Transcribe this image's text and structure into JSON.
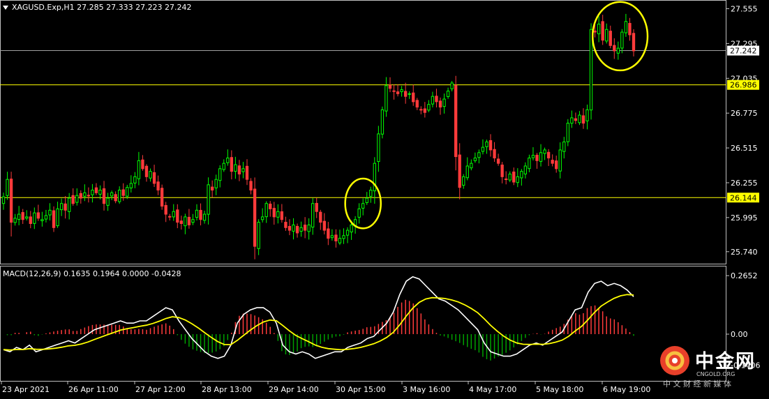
{
  "window": {
    "symbol_header": "XAGUSD.Exp,H1 27.285 27.333 27.223 27.242"
  },
  "indicator": {
    "header": "MACD(12,26,9) 0.1635 0.1964 0.0000 -0.0428"
  },
  "watermark": {
    "brand": "中金网",
    "site": "CNGOLD.ORG",
    "tagline": "中 文 财 经 新 媒 体"
  },
  "colors": {
    "up": "#00ff00",
    "down": "#ff3b3b",
    "hline": "#ffff00",
    "macd_main": "#ffffff",
    "macd_signal": "#ffff00",
    "hist_pos": "#ff3b3b",
    "hist_neg": "#00a000",
    "grid": "#c0c0c0",
    "circle": "#ffff00"
  },
  "chart_data": [
    {
      "type": "candlestick",
      "title": "XAGUSD.Exp,H1",
      "ylim": [
        25.64,
        27.62
      ],
      "y_ticks": [
        27.555,
        27.295,
        27.035,
        26.775,
        26.515,
        26.255,
        25.995,
        25.74
      ],
      "x_ticks": [
        "23 Apr 2021",
        "26 Apr 11:00",
        "27 Apr 12:00",
        "28 Apr 13:00",
        "29 Apr 14:00",
        "30 Apr 15:00",
        "3 May 16:00",
        "4 May 17:00",
        "5 May 18:00",
        "6 May 19:00"
      ],
      "horizontal_lines": [
        27.242,
        26.986,
        26.144
      ],
      "last_price": "27.242",
      "closes": [
        26.15,
        26.28,
        25.96,
        25.99,
        26.02,
        25.98,
        26.0,
        25.95,
        26.03,
        25.99,
        25.98,
        26.01,
        26.05,
        25.92,
        26.06,
        26.1,
        26.05,
        26.14,
        26.1,
        26.16,
        26.14,
        26.18,
        26.16,
        26.2,
        26.18,
        26.2,
        26.1,
        26.14,
        26.18,
        26.12,
        26.2,
        26.16,
        26.22,
        26.25,
        26.3,
        26.42,
        26.36,
        26.3,
        26.34,
        26.25,
        26.2,
        26.08,
        26.02,
        26.0,
        26.04,
        25.96,
        25.95,
        26.0,
        25.94,
        25.98,
        26.05,
        25.98,
        26.02,
        26.24,
        26.2,
        26.28,
        26.36,
        26.4,
        26.44,
        26.34,
        26.39,
        26.32,
        26.36,
        26.28,
        26.2,
        25.78,
        25.96,
        26.0,
        26.1,
        26.06,
        26.0,
        26.04,
        25.98,
        25.92,
        25.9,
        25.94,
        25.88,
        25.92,
        25.9,
        25.94,
        26.1,
        26.04,
        25.96,
        25.9,
        25.84,
        25.86,
        25.82,
        25.84,
        25.86,
        25.9,
        25.94,
        25.98,
        26.06,
        26.1,
        26.14,
        26.2,
        26.4,
        26.62,
        26.8,
        26.98,
        26.96,
        26.94,
        26.92,
        26.95,
        26.9,
        26.92,
        26.86,
        26.82,
        26.8,
        26.78,
        26.84,
        26.9,
        26.86,
        26.82,
        26.88,
        26.94,
        27.0,
        26.45,
        26.22,
        26.3,
        26.38,
        26.4,
        26.44,
        26.48,
        26.52,
        26.56,
        26.5,
        26.44,
        26.4,
        26.3,
        26.28,
        26.32,
        26.26,
        26.3,
        26.34,
        26.38,
        26.44,
        26.46,
        26.42,
        26.48,
        26.5,
        26.44,
        26.4,
        26.36,
        26.5,
        26.56,
        26.7,
        26.74,
        26.72,
        26.76,
        26.7,
        26.8,
        27.4,
        27.38,
        27.44,
        27.32,
        27.4,
        27.28,
        27.24,
        27.26,
        27.38,
        27.46,
        27.36,
        27.24
      ]
    },
    {
      "type": "macd",
      "title": "MACD(12,26,9)",
      "ylim": [
        -0.215,
        0.31
      ],
      "y_ticks": [
        0.2652,
        0.0,
        -0.1406
      ],
      "main": [
        -0.07,
        -0.08,
        -0.06,
        -0.07,
        -0.05,
        -0.08,
        -0.07,
        -0.06,
        -0.05,
        -0.04,
        -0.03,
        -0.04,
        -0.02,
        0.0,
        0.02,
        0.03,
        0.04,
        0.05,
        0.06,
        0.05,
        0.05,
        0.06,
        0.06,
        0.08,
        0.1,
        0.12,
        0.11,
        0.06,
        0.02,
        -0.02,
        -0.05,
        -0.08,
        -0.1,
        -0.11,
        -0.1,
        -0.05,
        0.05,
        0.09,
        0.11,
        0.12,
        0.12,
        0.1,
        0.05,
        -0.05,
        -0.08,
        -0.09,
        -0.08,
        -0.09,
        -0.11,
        -0.1,
        -0.09,
        -0.08,
        -0.08,
        -0.06,
        -0.05,
        -0.04,
        -0.02,
        -0.01,
        0.02,
        0.05,
        0.1,
        0.18,
        0.24,
        0.26,
        0.25,
        0.22,
        0.19,
        0.16,
        0.15,
        0.13,
        0.11,
        0.08,
        0.05,
        0.02,
        -0.04,
        -0.08,
        -0.09,
        -0.1,
        -0.1,
        -0.09,
        -0.07,
        -0.05,
        -0.04,
        -0.05,
        -0.03,
        -0.01,
        0.01,
        0.06,
        0.11,
        0.12,
        0.19,
        0.23,
        0.24,
        0.22,
        0.23,
        0.22,
        0.2,
        0.17
      ]
    }
  ]
}
